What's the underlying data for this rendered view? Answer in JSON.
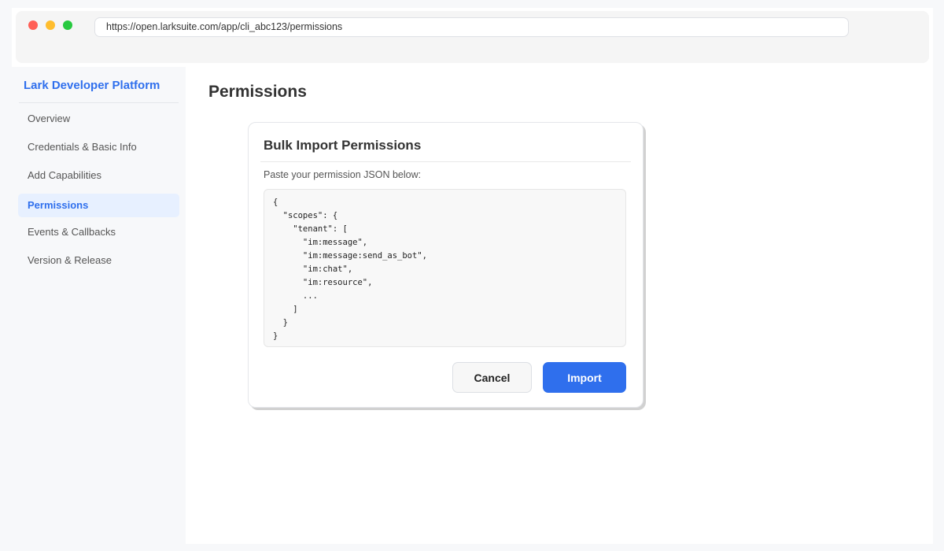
{
  "browser": {
    "url": "https://open.larksuite.com/app/cli_abc123/permissions"
  },
  "sidebar": {
    "brand": "Lark Developer Platform",
    "items": [
      {
        "label": "Overview"
      },
      {
        "label": "Credentials & Basic Info"
      },
      {
        "label": "Add Capabilities"
      },
      {
        "label": "Permissions",
        "active": true
      },
      {
        "label": "Events & Callbacks"
      },
      {
        "label": "Version & Release"
      }
    ]
  },
  "main": {
    "title": "Permissions"
  },
  "dialog": {
    "title": "Bulk Import Permissions",
    "label": "Paste your permission JSON below:",
    "json_text": "{\n  \"scopes\": {\n    \"tenant\": [\n      \"im:message\",\n      \"im:message:send_as_bot\",\n      \"im:chat\",\n      \"im:resource\",\n      ...\n    ]\n  }\n}",
    "cancel_label": "Cancel",
    "import_label": "Import"
  },
  "colors": {
    "accent": "#2f6fed",
    "active_nav_bg": "#e7f0ff"
  }
}
